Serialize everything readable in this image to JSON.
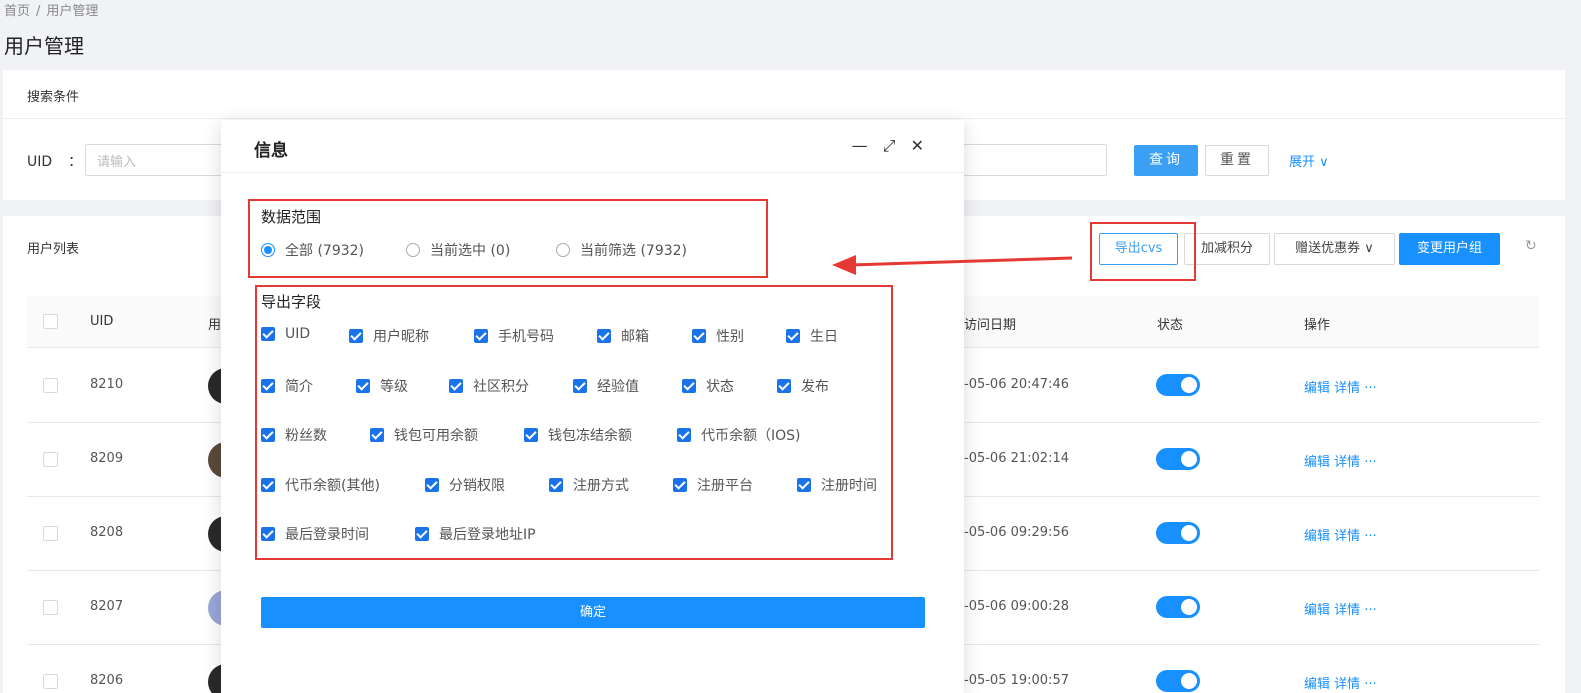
{
  "breadcrumb": {
    "home": "首页",
    "sep": "/",
    "current": "用户管理"
  },
  "page_title": "用户管理",
  "search": {
    "title": "搜索条件",
    "uid_label": "UID",
    "uid_colon": "：",
    "uid_placeholder": "请输入",
    "query_label": "查询",
    "reset_label": "重置",
    "expand_label": "展开 ∨"
  },
  "list": {
    "title": "用户列表",
    "export_label": "导出cvs",
    "points_label": "加减积分",
    "coupon_label": "赠送优惠券 ∨",
    "group_label": "变更用户组",
    "refresh_icon": "↻",
    "columns": {
      "uid": "UID",
      "nickname": "用",
      "visit": "访问日期",
      "status": "状态",
      "ops": "操作"
    },
    "rows": [
      {
        "uid": "8210",
        "visit": "-05-06 20:47:46",
        "ops": "编辑 详情 ···"
      },
      {
        "uid": "8209",
        "visit": "-05-06 21:02:14",
        "ops": "编辑 详情 ···"
      },
      {
        "uid": "8208",
        "visit": "-05-06 09:29:56",
        "ops": "编辑 详情 ···"
      },
      {
        "uid": "8207",
        "visit": "-05-06 09:00:28",
        "ops": "编辑 详情 ···"
      },
      {
        "uid": "8206",
        "visit": "-05-05 19:00:57",
        "ops": "编辑 详情 ···"
      }
    ]
  },
  "modal": {
    "title": "信息",
    "minimize_icon": "—",
    "maximize_icon": "⤢",
    "close_icon": "✕",
    "range_label": "数据范围",
    "range_options": [
      "全部  (7932)",
      "当前选中  (0)",
      "当前筛选  (7932)"
    ],
    "fields_label": "导出字段",
    "fields": [
      "UID",
      "用户昵称",
      "手机号码",
      "邮箱",
      "性别",
      "生日",
      "简介",
      "等级",
      "社区积分",
      "经验值",
      "状态",
      "发布",
      "粉丝数",
      "钱包可用余额",
      "钱包冻结余额",
      "代币余额（IOS)",
      "代币余额(其他)",
      "分销权限",
      "注册方式",
      "注册平台",
      "注册时间",
      "最后登录时间",
      "最后登录地址IP"
    ],
    "confirm_label": "确定"
  },
  "colors": {
    "accent": "#1890ff",
    "annotation": "#e53935"
  }
}
